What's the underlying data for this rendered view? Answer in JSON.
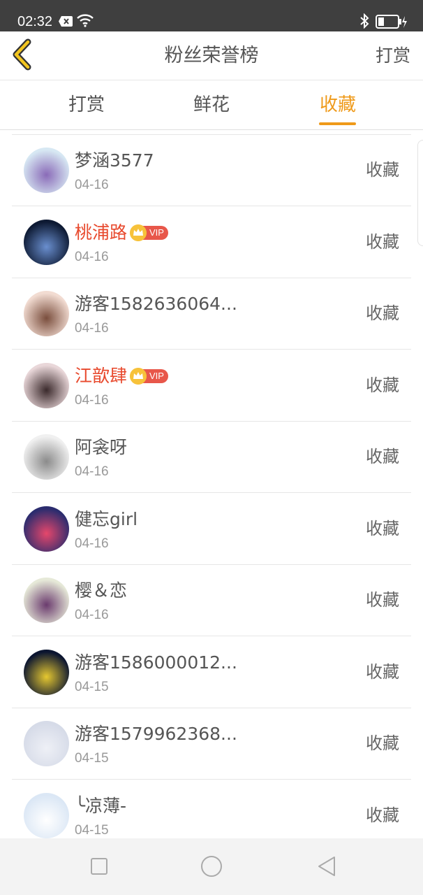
{
  "status_bar": {
    "time": "02:32"
  },
  "nav": {
    "title": "粉丝荣誉榜",
    "right_label": "打赏"
  },
  "tabs": [
    {
      "label": "打赏",
      "active": false
    },
    {
      "label": "鲜花",
      "active": false
    },
    {
      "label": "收藏",
      "active": true
    }
  ],
  "colors": {
    "accent": "#ef9a1a",
    "vip_name": "#e84a2e",
    "vip_badge": "#e8574a"
  },
  "list": [
    {
      "name": "梦涵3577",
      "date": "04-16",
      "action": "收藏",
      "vip": false,
      "avatar_colors": [
        "#d7e8f3",
        "#8a6bb8"
      ]
    },
    {
      "name": "桃浦路",
      "date": "04-16",
      "action": "收藏",
      "vip": true,
      "vip_label": "VIP",
      "avatar_colors": [
        "#0e1a33",
        "#6a8fcf"
      ]
    },
    {
      "name": "游客1582636064...",
      "date": "04-16",
      "action": "收藏",
      "vip": false,
      "avatar_colors": [
        "#f2dcd2",
        "#7a4e3d"
      ]
    },
    {
      "name": "江歆肆",
      "date": "04-16",
      "action": "收藏",
      "vip": true,
      "vip_label": "VIP",
      "avatar_colors": [
        "#e9d7d9",
        "#3b2a2c"
      ]
    },
    {
      "name": "阿衾呀",
      "date": "04-16",
      "action": "收藏",
      "vip": false,
      "avatar_colors": [
        "#f0f0f0",
        "#8b8b8b"
      ]
    },
    {
      "name": "健忘girl",
      "date": "04-16",
      "action": "收藏",
      "vip": false,
      "avatar_colors": [
        "#2b2c6e",
        "#e6476b"
      ]
    },
    {
      "name": "樱＆恋",
      "date": "04-16",
      "action": "收藏",
      "vip": false,
      "avatar_colors": [
        "#e6e9d8",
        "#6b3b6e"
      ]
    },
    {
      "name": "游客1586000012...",
      "date": "04-15",
      "action": "收藏",
      "vip": false,
      "avatar_colors": [
        "#0b1530",
        "#e6c830"
      ]
    },
    {
      "name": "游客1579962368...",
      "date": "04-15",
      "action": "收藏",
      "vip": false,
      "avatar_colors": [
        "#d6dbe8",
        "#eef0f6"
      ]
    },
    {
      "name": "╰凉薄-",
      "date": "04-15",
      "action": "收藏",
      "vip": false,
      "avatar_colors": [
        "#dbe7f5",
        "#ffffff"
      ]
    }
  ]
}
